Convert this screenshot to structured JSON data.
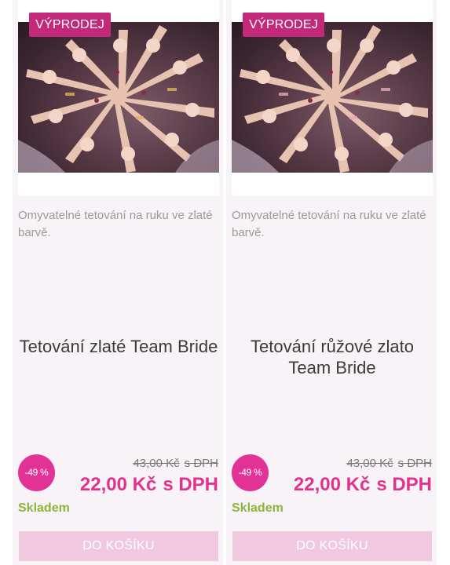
{
  "products": [
    {
      "sale_label": "VÝPRODEJ",
      "description": "Omyvatelné tetování na ruku ve zlaté barvě.",
      "title": "Tetování zlaté Team Bride",
      "discount": "-49 %",
      "old_price": "43,00 Kč",
      "old_price_vat": "s DPH",
      "new_price": "22,00 Kč",
      "new_price_vat": "s DPH",
      "stock": "Skladem",
      "cart_label": "DO KOŠÍKU"
    },
    {
      "sale_label": "VÝPRODEJ",
      "description": "Omyvatelné tetování na ruku ve zlaté barvě.",
      "title": "Tetování růžové zlato Team Bride",
      "discount": "-49 %",
      "old_price": "43,00 Kč",
      "old_price_vat": "s DPH",
      "new_price": "22,00 Kč",
      "new_price_vat": "s DPH",
      "stock": "Skladem",
      "cart_label": "DO KOŠÍKU"
    }
  ],
  "colors": {
    "sale_badge": "#c2297b",
    "discount_badge": "#e33295",
    "price": "#e0328f",
    "stock": "#8ab63a",
    "cart_button": "#f0c9de",
    "card_background": "#f8f3f7"
  }
}
